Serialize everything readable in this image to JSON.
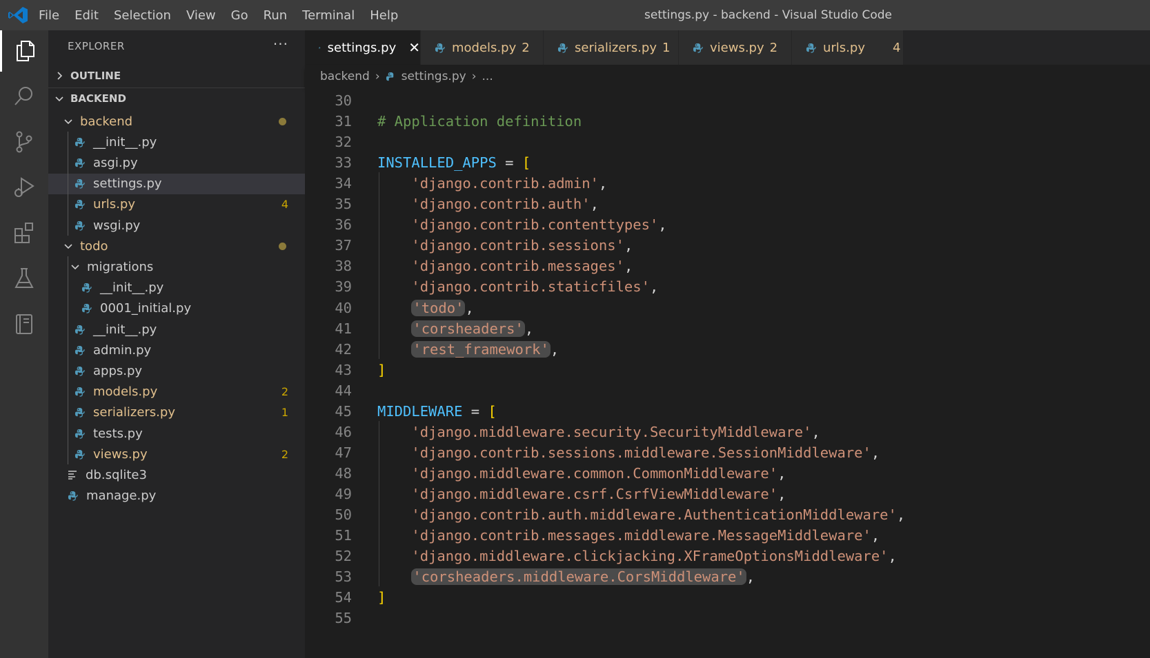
{
  "titlebar": {
    "menu": [
      "File",
      "Edit",
      "Selection",
      "View",
      "Go",
      "Run",
      "Terminal",
      "Help"
    ],
    "window_title": "settings.py - backend - Visual Studio Code"
  },
  "activity_bar": {
    "icons": [
      "files-icon",
      "search-icon",
      "source-control-icon",
      "run-debug-icon",
      "extensions-icon",
      "testing-icon",
      "notebook-icon"
    ],
    "active": "files-icon"
  },
  "sidebar": {
    "header": "EXPLORER",
    "more": "···",
    "outline_label": "OUTLINE",
    "project_label": "BACKEND",
    "tree": [
      {
        "label": "backend",
        "kind": "folder",
        "status": "modified-dot"
      },
      {
        "label": "__init__.py",
        "kind": "py"
      },
      {
        "label": "asgi.py",
        "kind": "py"
      },
      {
        "label": "settings.py",
        "kind": "py",
        "selected": true
      },
      {
        "label": "urls.py",
        "kind": "py",
        "badge": "4"
      },
      {
        "label": "wsgi.py",
        "kind": "py"
      },
      {
        "label": "todo",
        "kind": "folder",
        "status": "modified-dot"
      },
      {
        "label": "migrations",
        "kind": "folder"
      },
      {
        "label": "__init__.py",
        "kind": "py"
      },
      {
        "label": "0001_initial.py",
        "kind": "py"
      },
      {
        "label": "__init__.py",
        "kind": "py"
      },
      {
        "label": "admin.py",
        "kind": "py"
      },
      {
        "label": "apps.py",
        "kind": "py"
      },
      {
        "label": "models.py",
        "kind": "py",
        "badge": "2"
      },
      {
        "label": "serializers.py",
        "kind": "py",
        "badge": "1"
      },
      {
        "label": "tests.py",
        "kind": "py"
      },
      {
        "label": "views.py",
        "kind": "py",
        "badge": "2"
      },
      {
        "label": "db.sqlite3",
        "kind": "db"
      },
      {
        "label": "manage.py",
        "kind": "py"
      }
    ]
  },
  "tabs": [
    {
      "label": "settings.py",
      "count": "",
      "active": true,
      "close": "✕"
    },
    {
      "label": "models.py",
      "count": "2"
    },
    {
      "label": "serializers.py",
      "count": "1"
    },
    {
      "label": "views.py",
      "count": "2"
    },
    {
      "label": "urls.py",
      "count": "4"
    }
  ],
  "breadcrumb": {
    "folder": "backend",
    "file": "settings.py",
    "tail": "..."
  },
  "editor": {
    "lines": [
      {
        "n": "30",
        "tokens": []
      },
      {
        "n": "31",
        "tokens": [
          {
            "t": "# Application definition",
            "c": "comment"
          }
        ]
      },
      {
        "n": "32",
        "tokens": []
      },
      {
        "n": "33",
        "tokens": [
          {
            "t": "INSTALLED_APPS",
            "c": "var"
          },
          {
            "t": " = ",
            "c": "op"
          },
          {
            "t": "[",
            "c": "brk"
          }
        ]
      },
      {
        "n": "34",
        "tokens": [
          {
            "t": "    ",
            "c": "op"
          },
          {
            "t": "'django.contrib.admin'",
            "c": "str"
          },
          {
            "t": ",",
            "c": "op"
          }
        ]
      },
      {
        "n": "35",
        "tokens": [
          {
            "t": "    ",
            "c": "op"
          },
          {
            "t": "'django.contrib.auth'",
            "c": "str"
          },
          {
            "t": ",",
            "c": "op"
          }
        ]
      },
      {
        "n": "36",
        "tokens": [
          {
            "t": "    ",
            "c": "op"
          },
          {
            "t": "'django.contrib.contenttypes'",
            "c": "str"
          },
          {
            "t": ",",
            "c": "op"
          }
        ]
      },
      {
        "n": "37",
        "tokens": [
          {
            "t": "    ",
            "c": "op"
          },
          {
            "t": "'django.contrib.sessions'",
            "c": "str"
          },
          {
            "t": ",",
            "c": "op"
          }
        ]
      },
      {
        "n": "38",
        "tokens": [
          {
            "t": "    ",
            "c": "op"
          },
          {
            "t": "'django.contrib.messages'",
            "c": "str"
          },
          {
            "t": ",",
            "c": "op"
          }
        ]
      },
      {
        "n": "39",
        "tokens": [
          {
            "t": "    ",
            "c": "op"
          },
          {
            "t": "'django.contrib.staticfiles'",
            "c": "str"
          },
          {
            "t": ",",
            "c": "op"
          }
        ]
      },
      {
        "n": "40",
        "tokens": [
          {
            "t": "    ",
            "c": "op"
          },
          {
            "t": "'todo'",
            "c": "str",
            "hl": true
          },
          {
            "t": ",",
            "c": "op"
          }
        ]
      },
      {
        "n": "41",
        "tokens": [
          {
            "t": "    ",
            "c": "op"
          },
          {
            "t": "'corsheaders'",
            "c": "str",
            "hl": true
          },
          {
            "t": ",",
            "c": "op"
          }
        ]
      },
      {
        "n": "42",
        "tokens": [
          {
            "t": "    ",
            "c": "op"
          },
          {
            "t": "'rest_framework'",
            "c": "str",
            "hl": true
          },
          {
            "t": ",",
            "c": "op"
          }
        ]
      },
      {
        "n": "43",
        "tokens": [
          {
            "t": "]",
            "c": "brk"
          }
        ]
      },
      {
        "n": "44",
        "tokens": []
      },
      {
        "n": "45",
        "tokens": [
          {
            "t": "MIDDLEWARE",
            "c": "var"
          },
          {
            "t": " = ",
            "c": "op"
          },
          {
            "t": "[",
            "c": "brk"
          }
        ]
      },
      {
        "n": "46",
        "tokens": [
          {
            "t": "    ",
            "c": "op"
          },
          {
            "t": "'django.middleware.security.SecurityMiddleware'",
            "c": "str"
          },
          {
            "t": ",",
            "c": "op"
          }
        ]
      },
      {
        "n": "47",
        "tokens": [
          {
            "t": "    ",
            "c": "op"
          },
          {
            "t": "'django.contrib.sessions.middleware.SessionMiddleware'",
            "c": "str"
          },
          {
            "t": ",",
            "c": "op"
          }
        ]
      },
      {
        "n": "48",
        "tokens": [
          {
            "t": "    ",
            "c": "op"
          },
          {
            "t": "'django.middleware.common.CommonMiddleware'",
            "c": "str"
          },
          {
            "t": ",",
            "c": "op"
          }
        ]
      },
      {
        "n": "49",
        "tokens": [
          {
            "t": "    ",
            "c": "op"
          },
          {
            "t": "'django.middleware.csrf.CsrfViewMiddleware'",
            "c": "str"
          },
          {
            "t": ",",
            "c": "op"
          }
        ]
      },
      {
        "n": "50",
        "tokens": [
          {
            "t": "    ",
            "c": "op"
          },
          {
            "t": "'django.contrib.auth.middleware.AuthenticationMiddleware'",
            "c": "str"
          },
          {
            "t": ",",
            "c": "op"
          }
        ]
      },
      {
        "n": "51",
        "tokens": [
          {
            "t": "    ",
            "c": "op"
          },
          {
            "t": "'django.contrib.messages.middleware.MessageMiddleware'",
            "c": "str"
          },
          {
            "t": ",",
            "c": "op"
          }
        ]
      },
      {
        "n": "52",
        "tokens": [
          {
            "t": "    ",
            "c": "op"
          },
          {
            "t": "'django.middleware.clickjacking.XFrameOptionsMiddleware'",
            "c": "str"
          },
          {
            "t": ",",
            "c": "op"
          }
        ]
      },
      {
        "n": "53",
        "tokens": [
          {
            "t": "    ",
            "c": "op"
          },
          {
            "t": "'corsheaders.middleware.CorsMiddleware'",
            "c": "str",
            "hl": true
          },
          {
            "t": ",",
            "c": "op"
          }
        ]
      },
      {
        "n": "54",
        "tokens": [
          {
            "t": "]",
            "c": "brk"
          }
        ]
      },
      {
        "n": "55",
        "tokens": []
      }
    ]
  },
  "colors": {
    "titlebar": "#3c3c3c",
    "activitybar": "#333333",
    "sidebar": "#252526",
    "editor": "#1e1e1e",
    "modified": "#e2c08d",
    "badge": "#cca700",
    "string": "#ce9178",
    "comment": "#6a9955",
    "variable": "#4fc1ff",
    "bracket": "#ffd700"
  }
}
